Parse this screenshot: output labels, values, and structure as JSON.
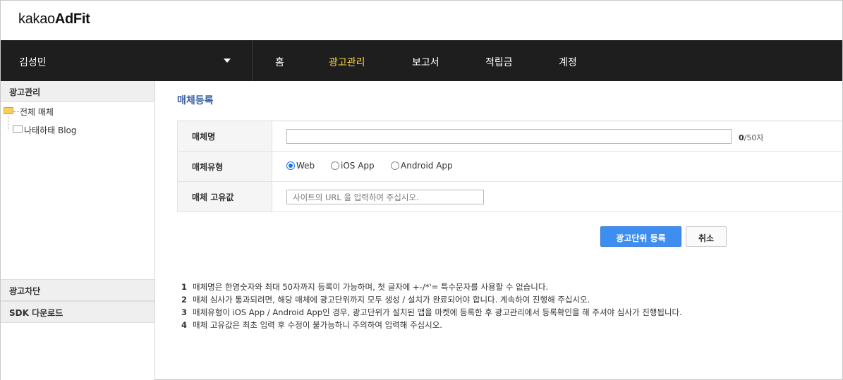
{
  "logo": {
    "prefix": "kakao",
    "brand": "AdFit"
  },
  "account": {
    "name": "김성민"
  },
  "menu": [
    "홈",
    "광고관리",
    "보고서",
    "적립금",
    "계정"
  ],
  "sidebar": {
    "header": "광고관리",
    "tree_root": "전체 매체",
    "tree_child": "나태하태 Blog",
    "bottom_items": [
      "광고차단",
      "SDK 다운로드"
    ]
  },
  "main": {
    "title": "매체등록",
    "fields": {
      "name_label": "매체명",
      "name_value": "",
      "counter_current": "0",
      "counter_max": "/50자",
      "type_label": "매체유형",
      "type_options": [
        "Web",
        "iOS App",
        "Android App"
      ],
      "type_selected": "Web",
      "unique_label": "매체 고유값",
      "unique_placeholder": "사이트의 URL 을 입력하여 주십시오."
    },
    "buttons": {
      "submit": "광고단위 등록",
      "cancel": "취소"
    },
    "notes": [
      {
        "num": "1",
        "text": "매체명은 한영숫자와 최대 50자까지 등록이 가능하며, 첫 글자에 +-/*'= 특수문자를 사용할 수 없습니다."
      },
      {
        "num": "2",
        "text": "매체 심사가 통과되려면, 해당 매체에 광고단위까지 모두 생성 / 설치가 완료되어야 합니다. 계속하여 진행해 주십시오."
      },
      {
        "num": "3",
        "text": "매체유형이 iOS App / Android App인 경우, 광고단위가 설치된 앱을 마켓에 등록한 후 광고관리에서 등록확인을 해 주셔야 심사가 진행됩니다."
      },
      {
        "num": "4",
        "text": "매체 고유값은 최초 입력 후 수정이 불가능하니 주의하여 입력해 주십시오."
      }
    ]
  },
  "colors": {
    "nav_bg": "#1e1e1e",
    "nav_active": "#ffd83c",
    "title": "#3b5fa0",
    "primary": "#3d8ef0",
    "radio": "#1a73e8"
  }
}
